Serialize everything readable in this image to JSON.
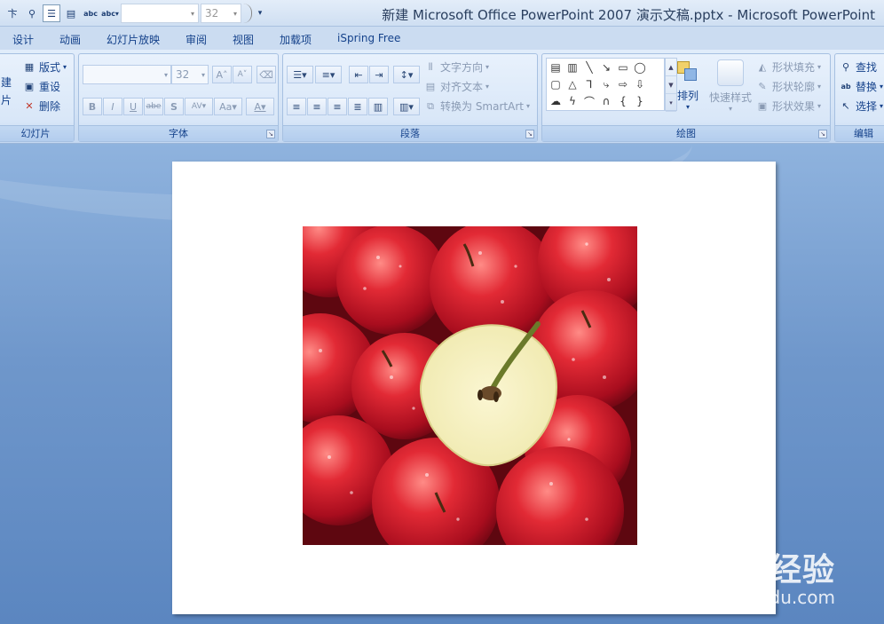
{
  "window": {
    "title": "新建 Microsoft Office PowerPoint 2007 演示文稿.pptx - Microsoft PowerPoint"
  },
  "quick_access": {
    "font_size_value": "32"
  },
  "tabs": [
    "设计",
    "动画",
    "幻灯片放映",
    "审阅",
    "视图",
    "加载项",
    "iSpring Free"
  ],
  "ribbon": {
    "slides_group": {
      "label": "幻灯片",
      "new_top": "建",
      "new_bottom": "片",
      "layout": "版式",
      "reset": "重设",
      "delete": "删除"
    },
    "font_group": {
      "label": "字体",
      "font_size_value": "32",
      "grow": "A",
      "shrink": "A",
      "bold": "B",
      "italic": "I",
      "underline": "U",
      "strike": "abe",
      "shadow": "S",
      "spacing": "AV",
      "case": "Aa",
      "color": "A"
    },
    "paragraph_group": {
      "label": "段落",
      "text_direction": "文字方向",
      "align_text": "对齐文本",
      "convert_smartart": "转换为 SmartArt"
    },
    "drawing_group": {
      "label": "绘图",
      "arrange": "排列",
      "quick_styles": "快速样式",
      "shape_fill": "形状填充",
      "shape_outline": "形状轮廓",
      "shape_effects": "形状效果"
    },
    "editing_group": {
      "label": "编辑",
      "find": "查找",
      "replace": "替换",
      "select": "选择"
    }
  },
  "watermark": {
    "main": "Baidu经验",
    "sub": "jingyan.baidu.com"
  }
}
